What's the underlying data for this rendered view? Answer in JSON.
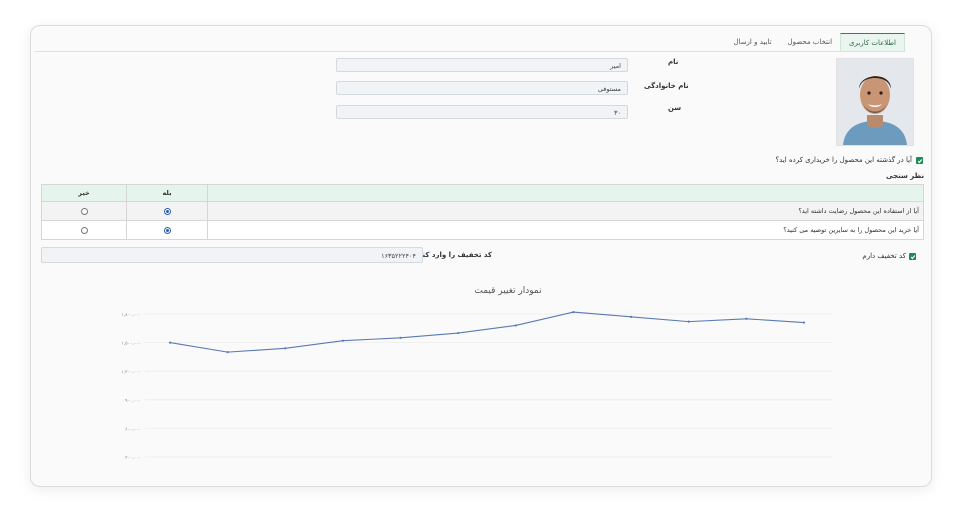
{
  "tabs": [
    {
      "label": "اطلاعات کاربری",
      "active": true
    },
    {
      "label": "انتخاب محصول",
      "active": false
    },
    {
      "label": "تایید و ارسال",
      "active": false
    }
  ],
  "form": {
    "first_name_label": "نام",
    "first_name_value": "امیر",
    "last_name_label": "نام خانوادگی",
    "last_name_value": "مستوفی",
    "age_label": "سن",
    "age_value": "۳۰"
  },
  "purchased_before": {
    "label": "آیا در گذشته این محصول را خریداری کرده اید؟",
    "checked": true
  },
  "survey": {
    "title": "نظر سنجی",
    "yes_label": "بله",
    "no_label": "خیر",
    "questions": [
      {
        "text": "آیا از استفاده این محصول رضایت داشته اید؟",
        "answer": "yes"
      },
      {
        "text": "آیا خرید این محصول را به سایرین توصیه می کنید؟",
        "answer": "yes"
      }
    ]
  },
  "discount": {
    "has_code_label": "کد تخفیف دارم",
    "has_code_checked": true,
    "enter_label": "کد تخفیف را وارد کنید.",
    "code_value": "۱۶۳۵۲۲۲۴۰۴"
  },
  "colors": {
    "accent": "#1f8a56",
    "line": "#5b79b3"
  },
  "chart_data": {
    "type": "line",
    "title": "نمودار تغییر قیمت",
    "yticks": [
      "۱,۸۰۰,۰۰۰",
      "۱,۵۰۰,۰۰۰",
      "۱,۲۰۰,۰۰۰",
      "۹۰۰,۰۰۰",
      "۶۰۰,۰۰۰",
      "۳۰۰,۰۰۰"
    ],
    "ylim": [
      300000,
      1800000
    ],
    "grid": true,
    "x": [
      1,
      2,
      3,
      4,
      5,
      6,
      7,
      8,
      9,
      10,
      11,
      12
    ],
    "values": [
      1500000,
      1400000,
      1440000,
      1520000,
      1550000,
      1600000,
      1680000,
      1820000,
      1770000,
      1720000,
      1750000,
      1710000
    ]
  }
}
